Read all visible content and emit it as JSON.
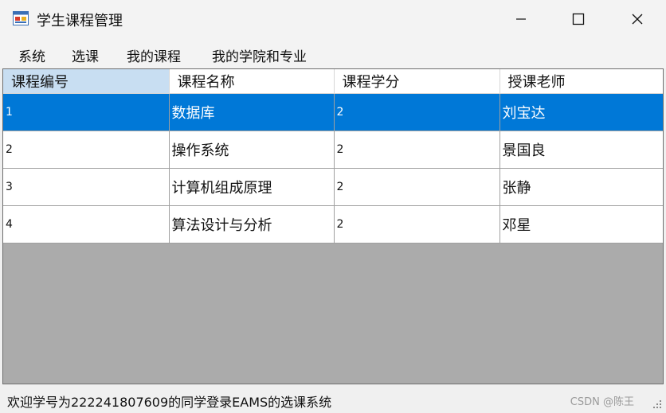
{
  "window": {
    "title": "学生课程管理"
  },
  "menu": {
    "items": [
      "系统",
      "选课",
      "我的课程",
      "我的学院和专业"
    ]
  },
  "table": {
    "columns": [
      "课程编号",
      "课程名称",
      "课程学分",
      "授课老师"
    ],
    "rows": [
      [
        "1",
        "数据库",
        "2",
        "刘宝达"
      ],
      [
        "2",
        "操作系统",
        "2",
        "景国良"
      ],
      [
        "3",
        "计算机组成原理",
        "2",
        "张静"
      ],
      [
        "4",
        "算法设计与分析",
        "2",
        "邓星"
      ]
    ],
    "selected_row": 0,
    "selected_column": 0
  },
  "status": {
    "text": "欢迎学号为222241807609的同学登录EAMS的选课系统",
    "watermark": "CSDN @陈王"
  },
  "colors": {
    "selection": "#0078d7",
    "header_selected": "#c8def2",
    "grid_background": "#ababab"
  },
  "icons": {
    "app": "window-app-icon",
    "minimize": "minimize-icon",
    "maximize": "maximize-icon",
    "close": "close-icon",
    "grip": "resize-grip-icon"
  }
}
